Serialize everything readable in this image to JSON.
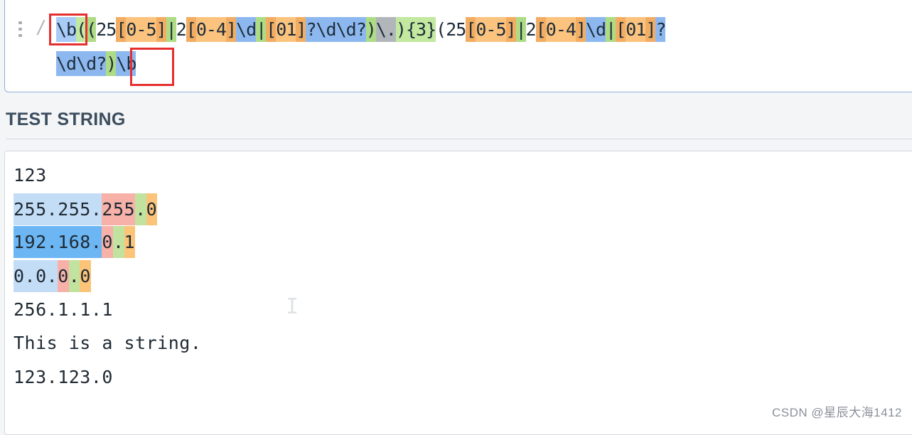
{
  "expression": {
    "delimiter": "/",
    "line1": [
      {
        "t": "\\b",
        "c": "t-blue"
      },
      {
        "t": "(",
        "c": "t-green2"
      },
      {
        "t": "(",
        "c": "t-green"
      },
      {
        "t": "25",
        "c": "t-plain"
      },
      {
        "t": "[",
        "c": "t-orange2"
      },
      {
        "t": "0-5",
        "c": "t-orange"
      },
      {
        "t": "]",
        "c": "t-orange2"
      },
      {
        "t": "|",
        "c": "t-green"
      },
      {
        "t": "2",
        "c": "t-plain"
      },
      {
        "t": "[",
        "c": "t-orange2"
      },
      {
        "t": "0-4",
        "c": "t-orange"
      },
      {
        "t": "]",
        "c": "t-orange2"
      },
      {
        "t": "\\d",
        "c": "t-blue2"
      },
      {
        "t": "|",
        "c": "t-green"
      },
      {
        "t": "[",
        "c": "t-orange2"
      },
      {
        "t": "01",
        "c": "t-orange"
      },
      {
        "t": "]",
        "c": "t-orange2"
      },
      {
        "t": "?\\d\\d?",
        "c": "t-blue2"
      },
      {
        "t": ")",
        "c": "t-green"
      },
      {
        "t": "\\.",
        "c": "t-gray"
      },
      {
        "t": ")",
        "c": "t-green2"
      },
      {
        "t": "{3}",
        "c": "t-green2"
      },
      {
        "t": "(",
        "c": "t-plain"
      },
      {
        "t": "25",
        "c": "t-plain"
      },
      {
        "t": "[",
        "c": "t-orange2"
      },
      {
        "t": "0-5",
        "c": "t-orange"
      },
      {
        "t": "]",
        "c": "t-orange2"
      },
      {
        "t": "|",
        "c": "t-green"
      },
      {
        "t": "2",
        "c": "t-plain"
      },
      {
        "t": "[",
        "c": "t-orange2"
      },
      {
        "t": "0-4",
        "c": "t-orange"
      },
      {
        "t": "]",
        "c": "t-orange2"
      },
      {
        "t": "\\d",
        "c": "t-blue2"
      },
      {
        "t": "|",
        "c": "t-green"
      },
      {
        "t": "[",
        "c": "t-orange2"
      },
      {
        "t": "01",
        "c": "t-orange"
      },
      {
        "t": "]",
        "c": "t-orange2"
      },
      {
        "t": "?",
        "c": "t-blue2"
      }
    ],
    "line2": [
      {
        "t": "\\d\\d?",
        "c": "t-blue2"
      },
      {
        "t": ")",
        "c": "t-green"
      },
      {
        "t": "\\b",
        "c": "t-blue2"
      }
    ]
  },
  "section_title": "TEST STRING",
  "test_lines": [
    [
      {
        "t": "123",
        "c": ""
      }
    ],
    [
      {
        "t": "255.255.",
        "c": "m-light"
      },
      {
        "t": "255",
        "c": "m-pink"
      },
      {
        "t": ".",
        "c": "m-green"
      },
      {
        "t": "0",
        "c": "m-orange"
      }
    ],
    [
      {
        "t": "192.168.",
        "c": "m-blue"
      },
      {
        "t": "0",
        "c": "m-pink"
      },
      {
        "t": ".",
        "c": "m-green"
      },
      {
        "t": "1",
        "c": "m-orange"
      }
    ],
    [
      {
        "t": "0.0.",
        "c": "m-light"
      },
      {
        "t": "0",
        "c": "m-pink"
      },
      {
        "t": ".",
        "c": "m-green"
      },
      {
        "t": "0",
        "c": "m-orange"
      }
    ],
    [
      {
        "t": "256.1.1.1",
        "c": ""
      }
    ],
    [
      {
        "t": "This is a string.",
        "c": ""
      }
    ],
    [
      {
        "t": "123.123.0",
        "c": ""
      }
    ]
  ],
  "text_cursor_glyph": "I",
  "watermark": "CSDN @星辰大海1412"
}
